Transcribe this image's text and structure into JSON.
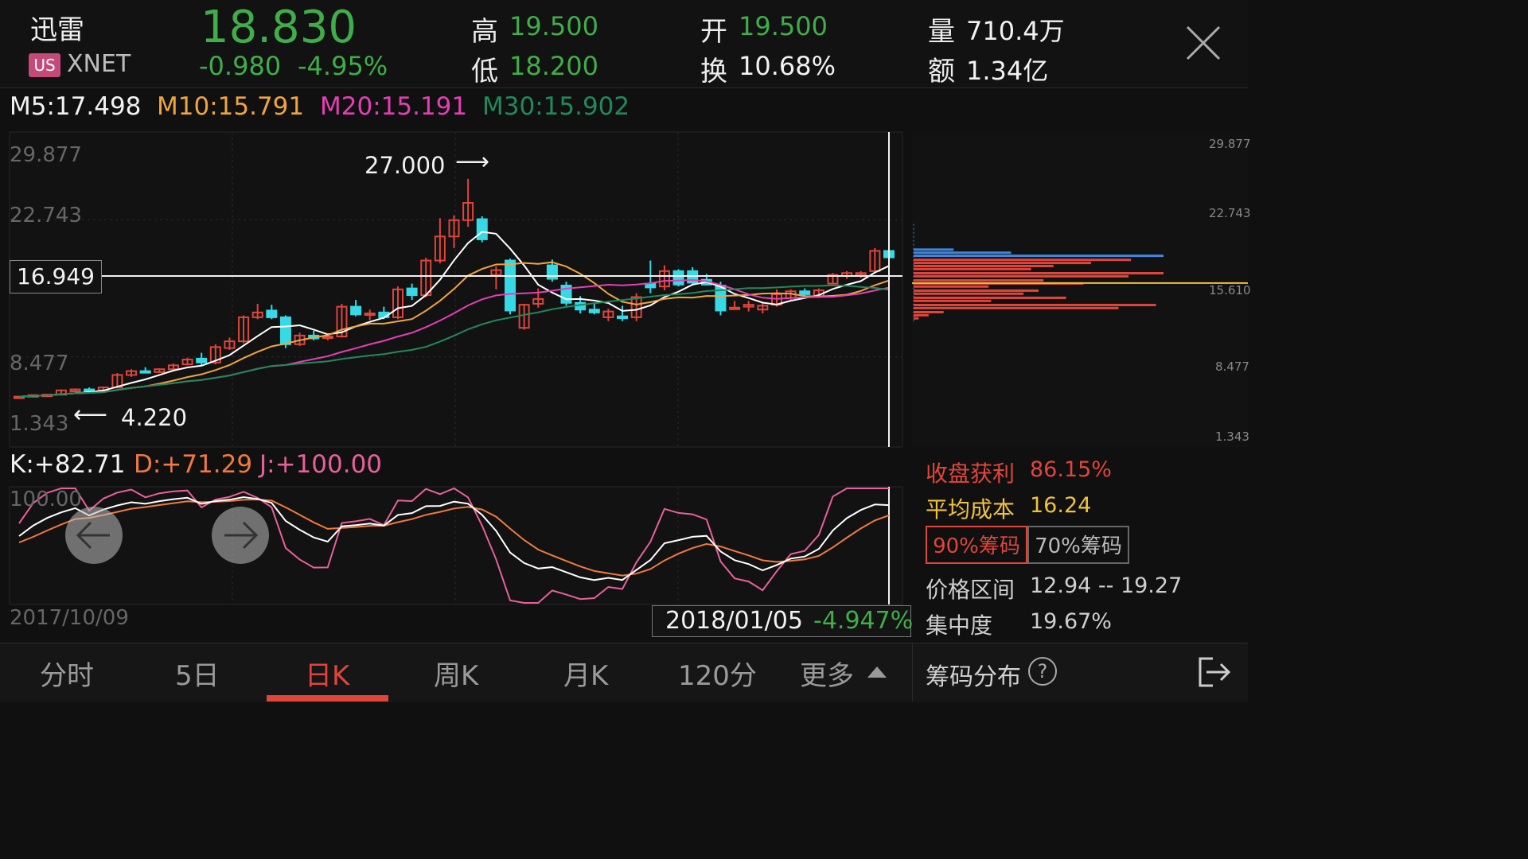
{
  "header": {
    "name": "迅雷",
    "market_badge": "US",
    "symbol": "XNET",
    "price": "18.830",
    "change": "-0.980",
    "change_pct": "-4.95%",
    "high_label": "高",
    "high_value": "19.500",
    "low_label": "低",
    "low_value": "18.200",
    "open_label": "开",
    "open_value": "19.500",
    "turnover_label": "换",
    "turnover_value": "10.68%",
    "volume_label": "量",
    "volume_value": "710.4万",
    "amount_label": "额",
    "amount_value": "1.34亿",
    "close_icon": "close-icon"
  },
  "ma": {
    "m5": "M5:17.498",
    "m10": "M10:15.791",
    "m20": "M20:15.191",
    "m30": "M30:15.902",
    "colors": {
      "m5": "#ffffff",
      "m10": "#f0a53c",
      "m20": "#e43fb6",
      "m30": "#1f8a5c"
    }
  },
  "kline": {
    "y_ticks": [
      "29.877",
      "22.743",
      "8.477",
      "1.343"
    ],
    "crosshair_value": "16.949",
    "max_annotation": "27.000",
    "min_annotation": "4.220",
    "start_date": "2017/10/09",
    "cursor_date": "2018/01/05",
    "cursor_change": "-4.947%"
  },
  "kdj": {
    "k": "K:+82.71",
    "d": "D:+71.29",
    "j": "J:+100.00",
    "y_top": "100.00",
    "colors": {
      "k": "#ffffff",
      "d": "#f07a3c",
      "j": "#e8609a"
    }
  },
  "chip": {
    "y_ticks": [
      "29.877",
      "22.743",
      "15.610",
      "8.477",
      "1.343"
    ],
    "profit_label": "收盘获利",
    "profit_value": "86.15%",
    "avg_cost_label": "平均成本",
    "avg_cost_value": "16.24",
    "btn_90": "90%筹码",
    "btn_70": "70%筹码",
    "range_label": "价格区间",
    "range_value": "12.94 -- 19.27",
    "conc_label": "集中度",
    "conc_value": "19.67%"
  },
  "tabs": [
    {
      "label": "分时",
      "active": false
    },
    {
      "label": "5日",
      "active": false
    },
    {
      "label": "日K",
      "active": true
    },
    {
      "label": "周K",
      "active": false
    },
    {
      "label": "月K",
      "active": false
    },
    {
      "label": "120分",
      "active": false
    },
    {
      "label": "更多",
      "active": false
    }
  ],
  "bottom_right": {
    "chip_label": "筹码分布",
    "help_icon": "help-icon",
    "exit_icon": "exit-icon"
  },
  "colors": {
    "up": "#e0453b",
    "down": "#36d9e6",
    "green_text": "#3fae49",
    "accent": "#e0453b"
  },
  "chart_data": {
    "type": "candlestick",
    "y_range": [
      1.343,
      29.877
    ],
    "candles": [
      [
        4.3,
        4.4,
        4.2,
        4.35
      ],
      [
        4.4,
        4.55,
        4.3,
        4.5
      ],
      [
        4.45,
        4.6,
        4.35,
        4.55
      ],
      [
        4.55,
        5.1,
        4.5,
        5.0
      ],
      [
        4.9,
        5.2,
        4.8,
        5.1
      ],
      [
        5.1,
        5.3,
        4.8,
        4.9
      ],
      [
        5.0,
        5.4,
        4.9,
        5.3
      ],
      [
        5.3,
        6.8,
        5.2,
        6.6
      ],
      [
        6.6,
        7.2,
        6.4,
        7.0
      ],
      [
        7.0,
        7.4,
        6.8,
        6.9
      ],
      [
        6.9,
        7.3,
        6.8,
        7.2
      ],
      [
        7.2,
        7.8,
        7.0,
        7.6
      ],
      [
        7.7,
        8.4,
        7.6,
        8.2
      ],
      [
        8.3,
        8.9,
        7.6,
        7.9
      ],
      [
        7.9,
        9.8,
        7.7,
        9.5
      ],
      [
        9.4,
        10.5,
        9.2,
        10.1
      ],
      [
        10.1,
        12.8,
        9.9,
        12.6
      ],
      [
        12.6,
        14.0,
        12.4,
        13.1
      ],
      [
        13.3,
        13.9,
        12.4,
        12.6
      ],
      [
        12.6,
        12.8,
        9.4,
        9.8
      ],
      [
        9.8,
        11.0,
        9.6,
        10.7
      ],
      [
        10.7,
        11.2,
        10.2,
        10.4
      ],
      [
        10.5,
        10.9,
        10.2,
        10.6
      ],
      [
        10.6,
        14.0,
        10.5,
        13.7
      ],
      [
        13.7,
        14.4,
        12.7,
        12.9
      ],
      [
        12.9,
        13.4,
        12.3,
        13.0
      ],
      [
        13.1,
        13.7,
        12.4,
        12.6
      ],
      [
        12.6,
        15.8,
        12.4,
        15.5
      ],
      [
        15.6,
        16.1,
        14.4,
        14.9
      ],
      [
        14.9,
        18.8,
        14.7,
        18.5
      ],
      [
        18.5,
        22.9,
        18.2,
        21.0
      ],
      [
        21.0,
        23.2,
        19.8,
        22.7
      ],
      [
        22.7,
        27.0,
        22.0,
        24.5
      ],
      [
        22.8,
        23.1,
        20.4,
        20.7
      ],
      [
        17.0,
        17.9,
        15.5,
        17.5
      ],
      [
        18.5,
        18.7,
        12.9,
        13.3
      ],
      [
        11.5,
        14.0,
        11.3,
        13.9
      ],
      [
        14.0,
        15.6,
        13.6,
        14.5
      ],
      [
        18.0,
        18.6,
        16.3,
        16.6
      ],
      [
        15.9,
        16.3,
        13.8,
        14.1
      ],
      [
        14.1,
        14.8,
        13.0,
        13.4
      ],
      [
        13.4,
        14.0,
        12.9,
        13.1
      ],
      [
        12.6,
        13.5,
        12.2,
        13.2
      ],
      [
        12.7,
        13.8,
        12.2,
        12.5
      ],
      [
        12.6,
        15.1,
        12.2,
        14.7
      ],
      [
        16.1,
        18.5,
        15.1,
        15.7
      ],
      [
        15.8,
        18.0,
        15.4,
        17.4
      ],
      [
        17.4,
        17.6,
        15.8,
        16.0
      ],
      [
        17.4,
        17.8,
        15.9,
        16.2
      ],
      [
        16.5,
        17.1,
        15.9,
        16.0
      ],
      [
        15.9,
        16.3,
        12.8,
        13.3
      ],
      [
        13.5,
        14.3,
        13.4,
        13.6
      ],
      [
        13.7,
        14.3,
        13.2,
        13.9
      ],
      [
        13.4,
        14.1,
        13.0,
        13.8
      ],
      [
        13.9,
        15.5,
        13.7,
        15.0
      ],
      [
        14.6,
        15.5,
        14.4,
        15.3
      ],
      [
        15.3,
        15.6,
        14.7,
        15.0
      ],
      [
        14.8,
        15.6,
        14.6,
        15.4
      ],
      [
        16.1,
        17.2,
        16.0,
        17.0
      ],
      [
        16.9,
        17.4,
        16.6,
        17.2
      ],
      [
        17.0,
        17.4,
        16.7,
        17.2
      ],
      [
        17.4,
        19.8,
        17.2,
        19.5
      ],
      [
        19.5,
        19.5,
        18.2,
        18.83
      ]
    ],
    "chip_bars": [
      {
        "price": 19.5,
        "pct": 0.16,
        "color": "#3e86de"
      },
      {
        "price": 19.2,
        "pct": 0.39,
        "color": "#3e86de"
      },
      {
        "price": 18.9,
        "pct": 1.0,
        "color": "#3e86de"
      },
      {
        "price": 18.5,
        "pct": 0.87,
        "color": "#e0453b"
      },
      {
        "price": 18.2,
        "pct": 0.71,
        "color": "#e0453b"
      },
      {
        "price": 17.9,
        "pct": 0.56,
        "color": "#e0453b"
      },
      {
        "price": 17.6,
        "pct": 0.47,
        "color": "#e0453b"
      },
      {
        "price": 17.2,
        "pct": 1.0,
        "color": "#e0453b"
      },
      {
        "price": 16.9,
        "pct": 0.86,
        "color": "#e0453b"
      },
      {
        "price": 16.5,
        "pct": 0.52,
        "color": "#e0453b"
      },
      {
        "price": 16.2,
        "pct": 0.68,
        "color": "#e0453b"
      },
      {
        "price": 15.9,
        "pct": 0.3,
        "color": "#e0453b"
      },
      {
        "price": 15.5,
        "pct": 0.5,
        "color": "#e0453b"
      },
      {
        "price": 15.2,
        "pct": 0.44,
        "color": "#e0453b"
      },
      {
        "price": 14.8,
        "pct": 0.61,
        "color": "#e0453b"
      },
      {
        "price": 14.5,
        "pct": 0.31,
        "color": "#e0453b"
      },
      {
        "price": 14.1,
        "pct": 0.97,
        "color": "#e0453b"
      },
      {
        "price": 13.8,
        "pct": 0.82,
        "color": "#e0453b"
      },
      {
        "price": 13.4,
        "pct": 0.12,
        "color": "#e0453b"
      },
      {
        "price": 13.1,
        "pct": 0.06,
        "color": "#e0453b"
      },
      {
        "price": 12.8,
        "pct": 0.02,
        "color": "#e0453b"
      }
    ],
    "chip_avg_cost": 16.24
  }
}
